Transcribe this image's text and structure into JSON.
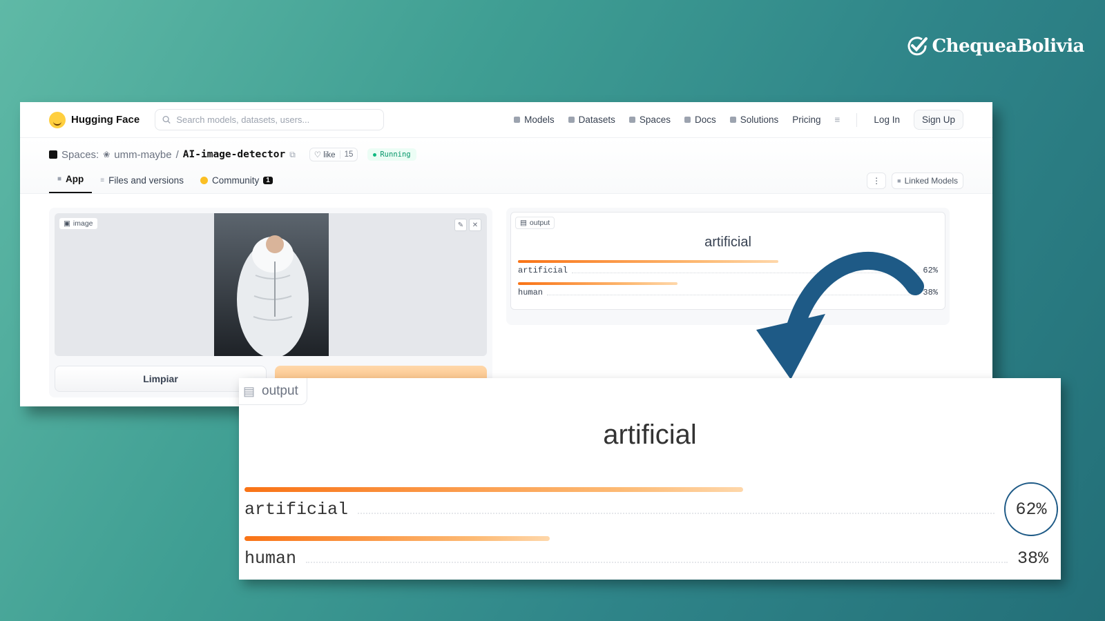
{
  "brand": {
    "name": "ChequeaBolivia"
  },
  "nav": {
    "logo": "Hugging Face",
    "search_placeholder": "Search models, datasets, users...",
    "links": [
      "Models",
      "Datasets",
      "Spaces",
      "Docs",
      "Solutions",
      "Pricing"
    ],
    "login": "Log In",
    "signup": "Sign Up"
  },
  "space": {
    "spaces_label": "Spaces:",
    "owner": "umm-maybe",
    "slash": "/",
    "repo": "AI-image-detector",
    "like_label": "like",
    "like_count": "15",
    "status": "Running"
  },
  "tabs": [
    {
      "label": "App"
    },
    {
      "label": "Files and versions"
    },
    {
      "label": "Community",
      "badge": "1"
    }
  ],
  "linked_models": "Linked Models",
  "input_panel": {
    "tag": "image",
    "clear_button": "Limpiar"
  },
  "output_panel": {
    "tag": "output",
    "prediction": "artificial",
    "labels": [
      {
        "name": "artificial",
        "pct": "62%",
        "value": 0.62
      },
      {
        "name": "human",
        "pct": "38%",
        "value": 0.38
      }
    ]
  },
  "colors": {
    "accent": "#f97316",
    "arrow": "#1e5a86"
  }
}
